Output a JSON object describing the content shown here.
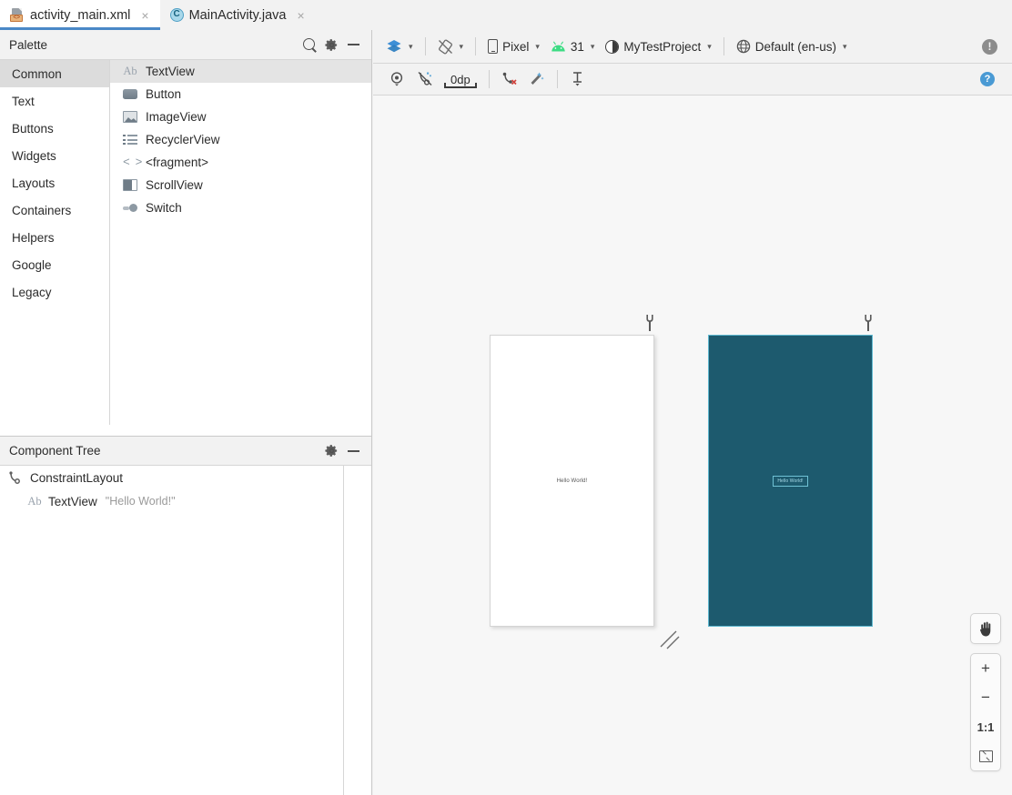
{
  "window": {
    "tabs": [
      {
        "label": "activity_main.xml",
        "icon": "xml-file-icon",
        "active": true,
        "close": "×"
      },
      {
        "label": "MainActivity.java",
        "icon": "java-class-icon",
        "active": false,
        "close": "×"
      }
    ]
  },
  "palette": {
    "title": "Palette",
    "actions": {
      "search": "search-icon",
      "gear": "gear-icon",
      "minimize": "minimize-icon"
    },
    "categories": [
      {
        "label": "Common",
        "selected": true
      },
      {
        "label": "Text",
        "selected": false
      },
      {
        "label": "Buttons",
        "selected": false
      },
      {
        "label": "Widgets",
        "selected": false
      },
      {
        "label": "Layouts",
        "selected": false
      },
      {
        "label": "Containers",
        "selected": false
      },
      {
        "label": "Helpers",
        "selected": false
      },
      {
        "label": "Google",
        "selected": false
      },
      {
        "label": "Legacy",
        "selected": false
      }
    ],
    "items": [
      {
        "label": "TextView",
        "icon": "textview-icon",
        "selected": true
      },
      {
        "label": "Button",
        "icon": "button-icon",
        "selected": false
      },
      {
        "label": "ImageView",
        "icon": "imageview-icon",
        "selected": false
      },
      {
        "label": "RecyclerView",
        "icon": "recyclerview-icon",
        "selected": false
      },
      {
        "label": "<fragment>",
        "icon": "fragment-icon",
        "selected": false
      },
      {
        "label": "ScrollView",
        "icon": "scrollview-icon",
        "selected": false
      },
      {
        "label": "Switch",
        "icon": "switch-icon",
        "selected": false
      }
    ]
  },
  "component_tree": {
    "title": "Component Tree",
    "actions": {
      "gear": "gear-icon",
      "minimize": "minimize-icon"
    },
    "nodes": [
      {
        "label": "ConstraintLayout",
        "value": "",
        "icon": "constraintlayout-icon",
        "level": 0
      },
      {
        "label": "TextView",
        "value": "\"Hello World!\"",
        "icon": "textview-icon",
        "level": 1
      }
    ]
  },
  "design_toolbar": {
    "view_mode": {
      "label": "",
      "icon": "layers-icon"
    },
    "orientation": {
      "label": "",
      "icon": "rotate-device-icon"
    },
    "device": {
      "label": "Pixel",
      "icon": "phone-icon",
      "chevron": "⌄"
    },
    "api_level": {
      "label": "31",
      "icon": "android-icon",
      "chevron": "⌄"
    },
    "theme": {
      "label": "MyTestProject",
      "icon": "theme-icon",
      "chevron": "⌄"
    },
    "locale": {
      "label": "Default (en-us)",
      "icon": "globe-icon",
      "chevron": "⌄"
    },
    "issues": {
      "label": "",
      "icon": "warning-icon"
    }
  },
  "constraint_toolbar": {
    "show_constraints": "show-constraints-icon",
    "autoconnect": "autoconnect-off-icon",
    "default_margin": "0dp",
    "clear_constraints": "clear-constraints-icon",
    "infer_constraints": "infer-constraints-icon",
    "guidelines": "guidelines-icon",
    "help": "?"
  },
  "canvas": {
    "design_preview": {
      "name": "design-surface-preview",
      "text": "Hello World!"
    },
    "blueprint_preview": {
      "name": "blueprint-surface-preview",
      "text": "Hello World!"
    },
    "wrench_icon": "render-options-icon",
    "resize_handle": "canvas-resize-handle"
  },
  "zoom_controls": {
    "pan": "✋",
    "zoom_in": "+",
    "zoom_out": "−",
    "actual_size": "1:1",
    "zoom_to_fit": "zoom-to-fit-icon"
  },
  "colors": {
    "accent_blue": "#4a88c7",
    "blueprint_bg": "#1d5a6e",
    "blueprint_stroke": "#6fc1d4",
    "panel_bg": "#f2f2f2",
    "canvas_bg": "#f7f7f7",
    "android_green": "#3ddc84"
  }
}
